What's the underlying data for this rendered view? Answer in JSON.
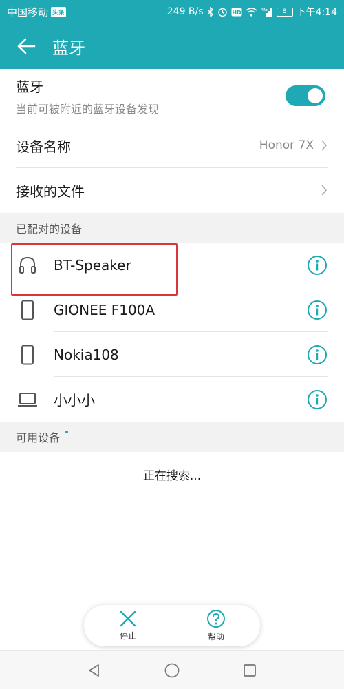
{
  "status_bar": {
    "carrier": "中国移动",
    "carrier_badge": "头条",
    "speed": "249 B/s",
    "network": "4G",
    "battery": "8",
    "time": "下午4:14"
  },
  "app_bar": {
    "title": "蓝牙",
    "back_icon": "arrow-left-icon"
  },
  "bluetooth": {
    "title": "蓝牙",
    "subtitle": "当前可被附近的蓝牙设备发现",
    "enabled": true
  },
  "device_name": {
    "label": "设备名称",
    "value": "Honor 7X"
  },
  "received_files": {
    "label": "接收的文件"
  },
  "paired_section": {
    "header": "已配对的设备",
    "devices": [
      {
        "name": "BT-Speaker",
        "icon": "headphones-icon"
      },
      {
        "name": "GIONEE F100A",
        "icon": "phone-icon"
      },
      {
        "name": "Nokia108",
        "icon": "phone-icon"
      },
      {
        "name": "小小小",
        "icon": "laptop-icon"
      }
    ]
  },
  "available_section": {
    "header": "可用设备",
    "status": "正在搜索..."
  },
  "bottom_actions": {
    "stop_label": "停止",
    "help_label": "帮助"
  },
  "colors": {
    "accent": "#1fa9b5",
    "highlight": "#d9353a"
  }
}
